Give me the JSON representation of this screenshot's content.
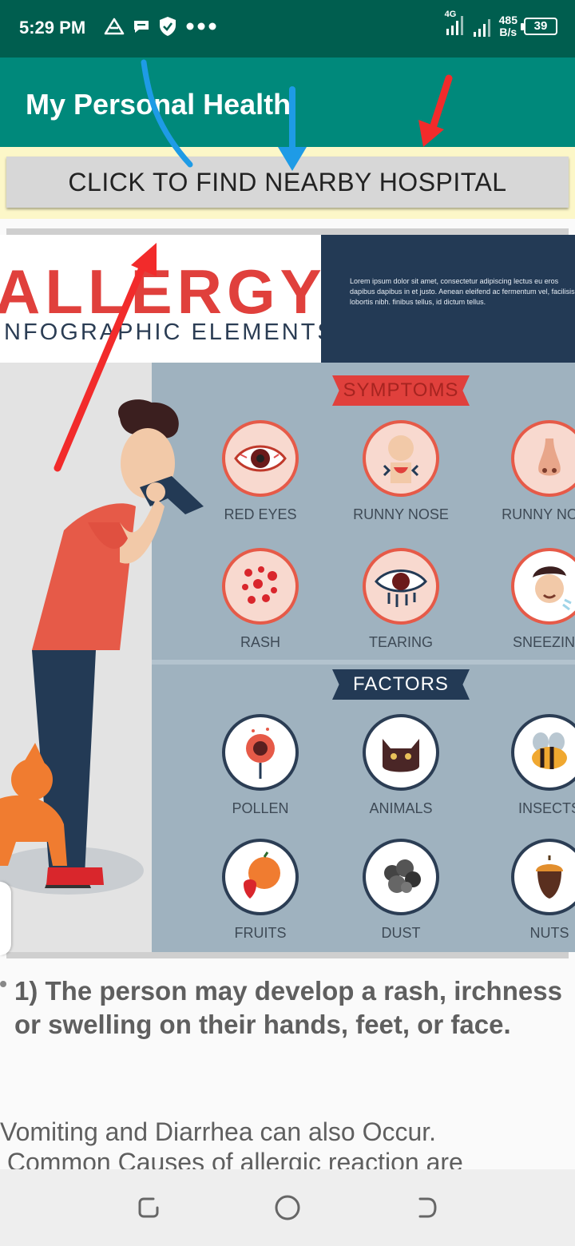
{
  "status_bar": {
    "time": "5:29 PM",
    "network_type": "4G",
    "net_speed_value": "485",
    "net_speed_unit": "B/s",
    "battery_level": "39"
  },
  "app_bar": {
    "title": "My Personal Health"
  },
  "actions": {
    "find_hospital_label": "CLICK TO FIND NEARBY HOSPITAL"
  },
  "infographic": {
    "title": "ALLERGY",
    "subtitle": "INFOGRAPHIC ELEMENTS",
    "lorem": "Lorem ipsum dolor sit amet, consectetur adipiscing lectus eu eros dapibus dapibus in et justo. Aenean eleifend ac fermentum vel, facilisis lobortis nibh. finibus tellus, id dictum tellus.",
    "symptoms_heading": "SYMPTOMS",
    "factors_heading": "FACTORS",
    "symptoms": [
      "RED EYES",
      "RUNNY NOSE",
      "RUNNY NOSE",
      "RASH",
      "TEARING",
      "SNEEZING"
    ],
    "factors": [
      "POLLEN",
      "ANIMALS",
      "INSECTS",
      "FRUITS",
      "DUST",
      "NUTS"
    ]
  },
  "content": {
    "point_one": "1) The person may develop a rash, irchness or swelling on their hands, feet, or face.",
    "para_line_1": "Vomiting and Diarrhea can also Occur.",
    "para_line_2": " Common Causes of allergic reaction are"
  },
  "colors": {
    "status_bar": "#005e4f",
    "app_bar": "#00897b",
    "button_strip": "#fcf7c8",
    "allergy_red": "#e0403c",
    "allergy_navy": "#233a55"
  }
}
